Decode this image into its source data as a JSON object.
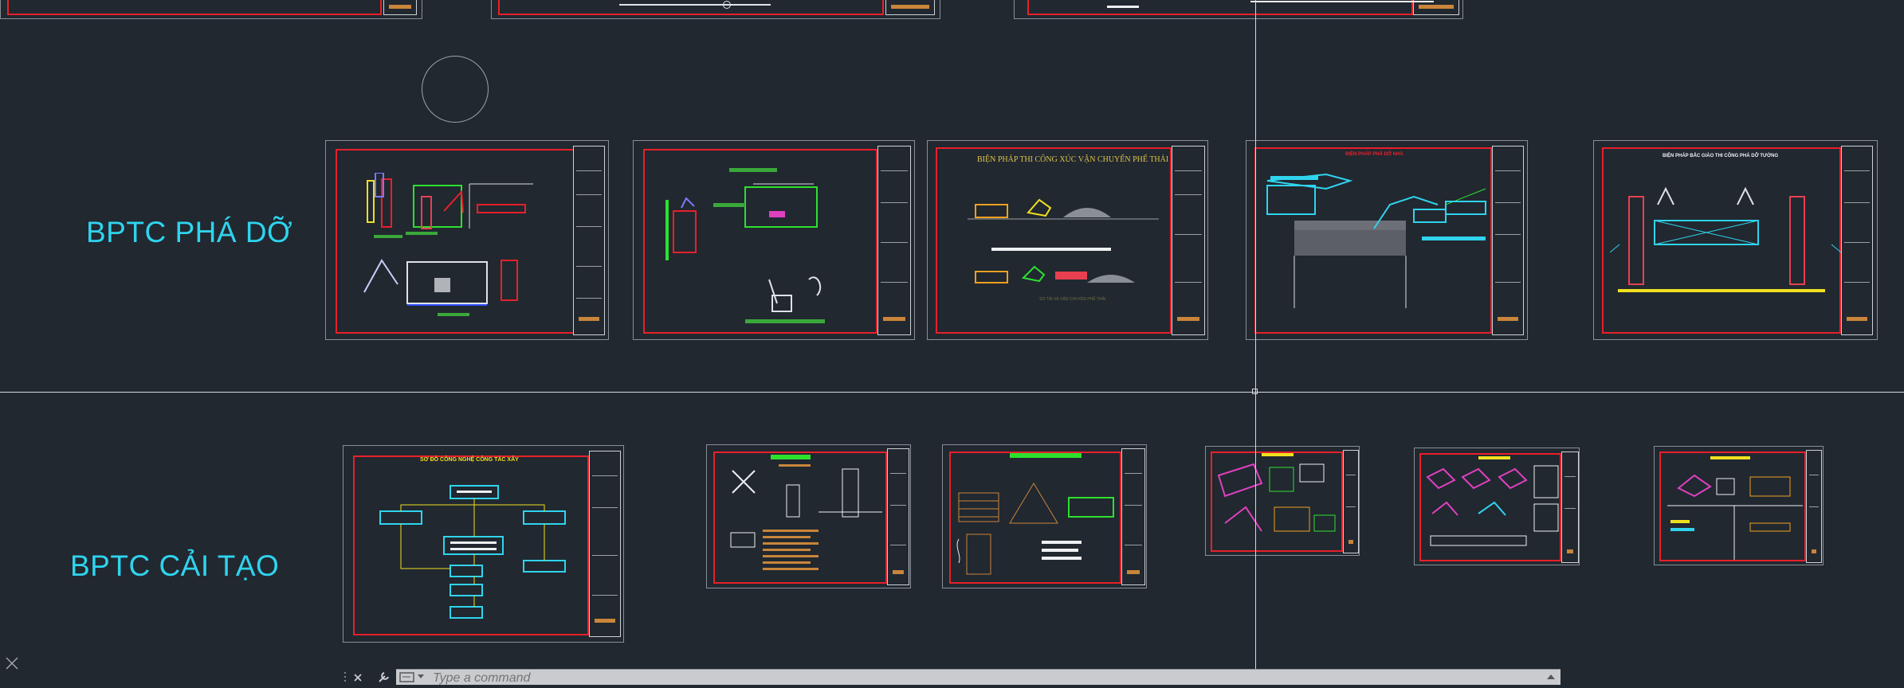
{
  "rows": [
    {
      "label": "BPTC PHÁ DỠ"
    },
    {
      "label": "BPTC CẢI TẠO"
    }
  ],
  "sheets": {
    "demolition_3": {
      "title": "BIỆN PHÁP THI CÔNG XÚC VẬN CHUYỂN PHẾ THẢI",
      "caption": "SƠ TẢI VÀ VẬN CHUYỂN PHẾ THẢI"
    },
    "demolition_4": {
      "title": "BIỆN PHÁP PHÁ DỠ NHÀ"
    },
    "demolition_5": {
      "title": "BIỆN PHÁP BẮC GIÀO THI CÔNG PHÁ DỠ TƯỜNG"
    },
    "renovation_1": {
      "title": "SƠ ĐỒ CÔNG NGHỆ CÔNG TÁC XÂY"
    }
  },
  "command_line": {
    "placeholder": "Type a command"
  },
  "colors": {
    "background": "#212830",
    "sheet_frame": "#e8202a",
    "label_cyan": "#2fd4ee",
    "crosshair": "#d7dade",
    "command_bar": "#c9cbce"
  },
  "icons": [
    "close-icon",
    "wrench-icon",
    "command-icon",
    "chevron-down-icon",
    "chevron-up-icon",
    "ucs-icon"
  ]
}
